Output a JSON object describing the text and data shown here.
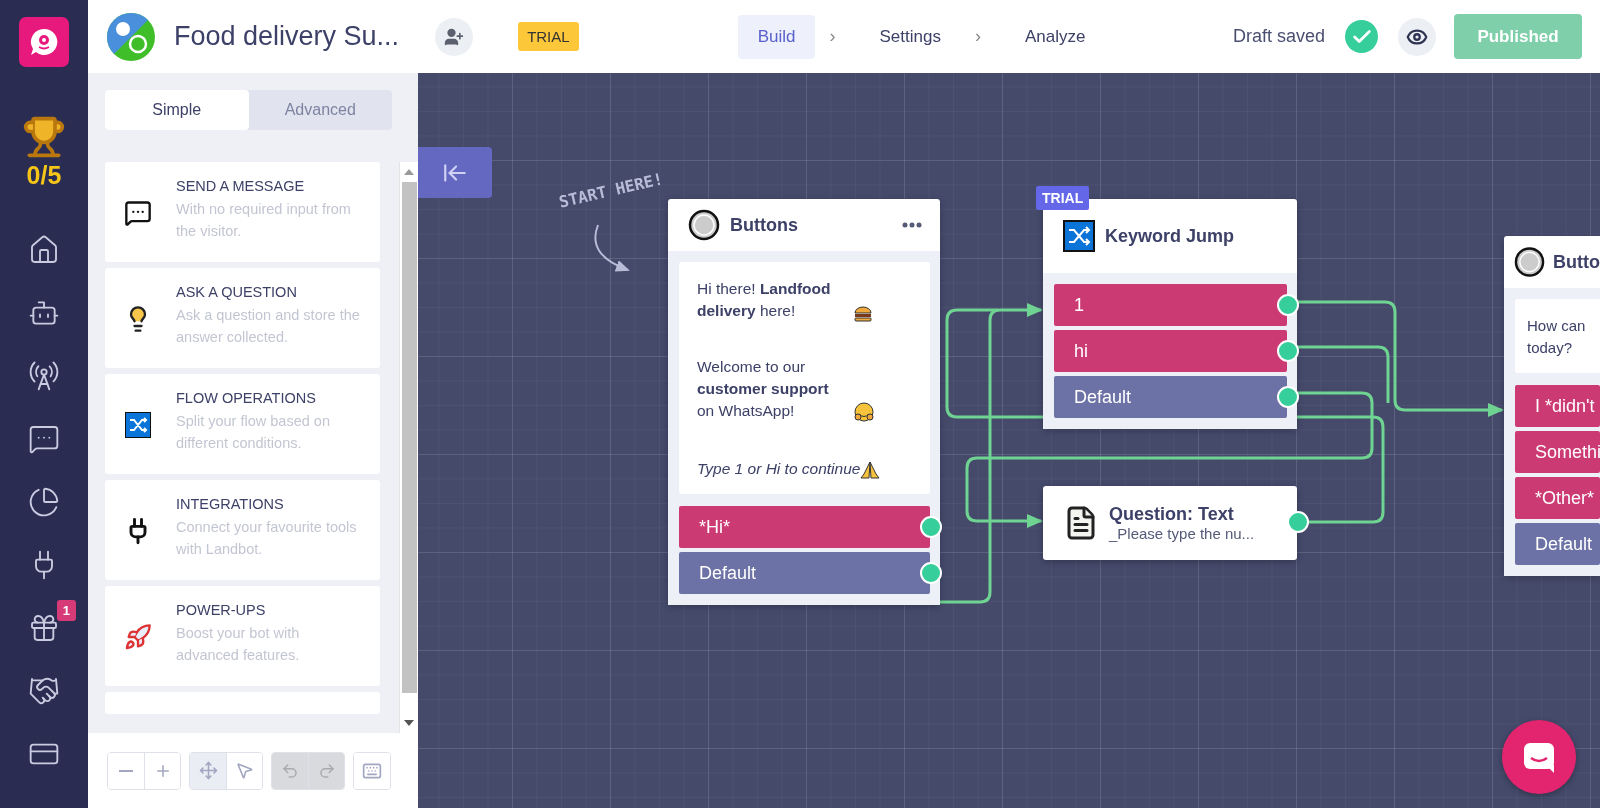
{
  "sidebar": {
    "score": "0/5",
    "items": [
      {
        "kind": "home"
      },
      {
        "kind": "bot"
      },
      {
        "kind": "broadcast"
      },
      {
        "kind": "chat"
      },
      {
        "kind": "analytics"
      },
      {
        "kind": "integrations"
      },
      {
        "kind": "gift",
        "badge": "1"
      },
      {
        "kind": "partners"
      },
      {
        "kind": "billing"
      }
    ]
  },
  "header": {
    "title": "Food delivery Su...",
    "badge": "TRIAL",
    "steps": [
      {
        "label": "Build",
        "selected": true
      },
      {
        "label": "Settings",
        "selected": false,
        "prefix": "›"
      },
      {
        "label": "Analyze",
        "selected": false,
        "prefix": "›"
      }
    ],
    "status": "Draft saved",
    "saved": true,
    "publish": {
      "label": "Published",
      "disabled": true
    }
  },
  "panel": {
    "tabs": [
      {
        "label": "Simple",
        "selected": true
      },
      {
        "label": "Advanced",
        "selected": false
      }
    ],
    "blocks": [
      {
        "kind": "message",
        "title": "SEND A MESSAGE",
        "description": "With no required input from the visitor."
      },
      {
        "kind": "question",
        "title": "ASK A QUESTION",
        "description": "Ask a question and store the answer collected."
      },
      {
        "kind": "flow",
        "title": "FLOW OPERATIONS",
        "description": "Split your flow based on different conditions."
      },
      {
        "kind": "integrations",
        "title": "INTEGRATIONS",
        "description": "Connect your favourite tools with Landbot."
      },
      {
        "kind": "powerups",
        "title": "POWER-UPS",
        "description": "Boost your bot with advanced features."
      }
    ],
    "tools": [
      {
        "kind": "pan",
        "selected": true
      },
      {
        "kind": "pointer",
        "selected": false
      }
    ],
    "history": [
      {
        "kind": "undo",
        "disabled": true
      },
      {
        "kind": "redo",
        "disabled": true
      }
    ]
  },
  "canvas": {
    "hint": "START HERE!",
    "nodes": [
      {
        "kind": "buttons",
        "title": "Buttons",
        "paragraphs": [
          {
            "text": "Hi there! **Landfood delivery** here!",
            "emoji": {
              "kind": "burger"
            },
            "italic": false
          },
          {
            "text": "Welcome to our **customer support** on WhatsApp!",
            "emoji": {
              "kind": "hug"
            },
            "italic": false
          },
          {
            "text": "Type 1 or Hi to continue",
            "emoji": {
              "kind": "pray"
            },
            "italic": true
          }
        ],
        "rows": [
          {
            "label": "*Hi*",
            "kind": "keyword"
          },
          {
            "label": "Default",
            "kind": "default"
          }
        ]
      },
      {
        "kind": "keyword",
        "badge": "TRIAL",
        "title": "Keyword Jump",
        "rows": [
          {
            "label": "1",
            "kind": "keyword"
          },
          {
            "label": "hi",
            "kind": "keyword"
          },
          {
            "label": "Default",
            "kind": "default"
          }
        ]
      },
      {
        "kind": "question",
        "title": "Question: Text",
        "subtitle": "_Please type the nu..."
      },
      {
        "kind": "buttons",
        "title": "Butto",
        "lines": [
          "How can",
          "today?"
        ],
        "rows": [
          {
            "label": "I *didn't",
            "kind": "keyword"
          },
          {
            "label": "Somethi",
            "kind": "keyword"
          },
          {
            "label": "*Other*",
            "kind": "keyword"
          },
          {
            "label": "Default",
            "kind": "default"
          }
        ]
      }
    ]
  }
}
